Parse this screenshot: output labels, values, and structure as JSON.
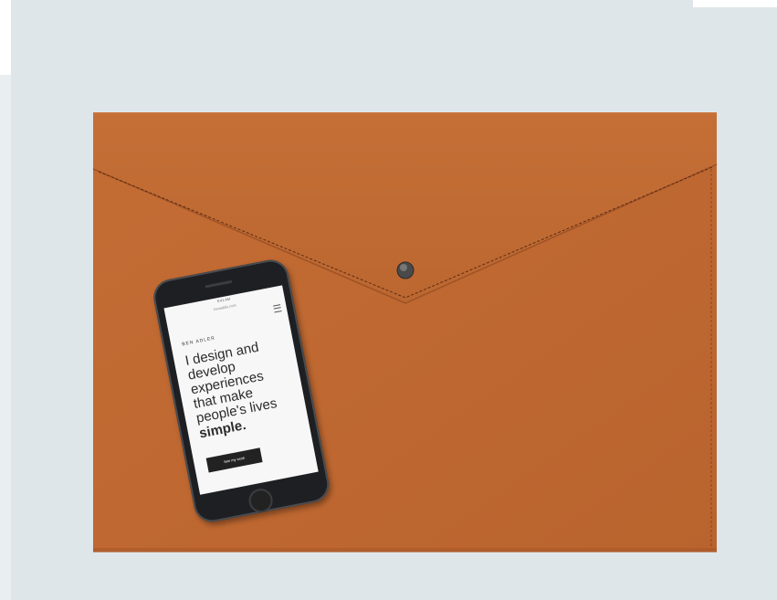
{
  "image": {
    "background_color": "#dfe6e9",
    "envelope_color": "#c06a32",
    "stitch_color": "#5a2c14"
  },
  "phone": {
    "status_time": "9:41 AM",
    "url": "benaddis.com",
    "brand": "BEN ADLER",
    "headline": "I design and develop experiences that make people's lives",
    "headline_bold": "simple.",
    "cta_label": "See my work"
  }
}
